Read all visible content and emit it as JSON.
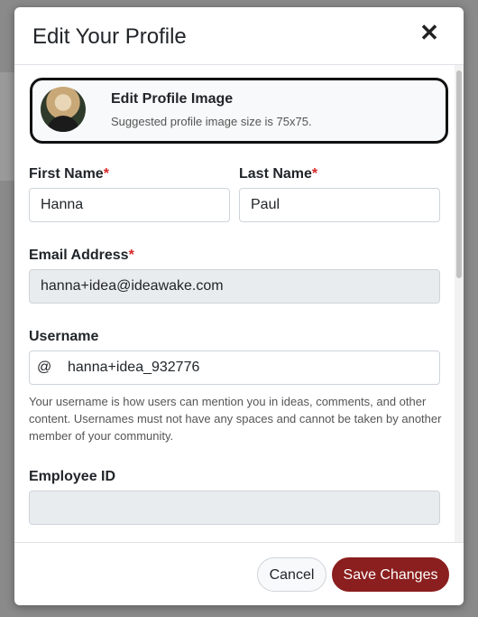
{
  "modal": {
    "title": "Edit Your Profile",
    "close_label": "✕"
  },
  "profile_image": {
    "title": "Edit Profile Image",
    "subtitle": "Suggested profile image size is 75x75."
  },
  "form": {
    "first_name": {
      "label": "First Name",
      "required_mark": "*",
      "value": "Hanna"
    },
    "last_name": {
      "label": "Last Name",
      "required_mark": "*",
      "value": "Paul"
    },
    "email": {
      "label": "Email Address",
      "required_mark": "*",
      "value": "hanna+idea@ideawake.com"
    },
    "username": {
      "label": "Username",
      "prefix": "@",
      "value": "hanna+idea_932776",
      "help": "Your username is how users can mention you in ideas, comments, and other content. Usernames must not have any spaces and cannot be taken by another member of your community."
    },
    "employee_id": {
      "label": "Employee ID",
      "value": ""
    }
  },
  "footer": {
    "cancel_label": "Cancel",
    "save_label": "Save Changes"
  },
  "colors": {
    "save_button": "#8b1e1e",
    "required_mark": "#d62828",
    "highlight_border": "#111111"
  },
  "icons": {
    "close": "close-icon"
  }
}
